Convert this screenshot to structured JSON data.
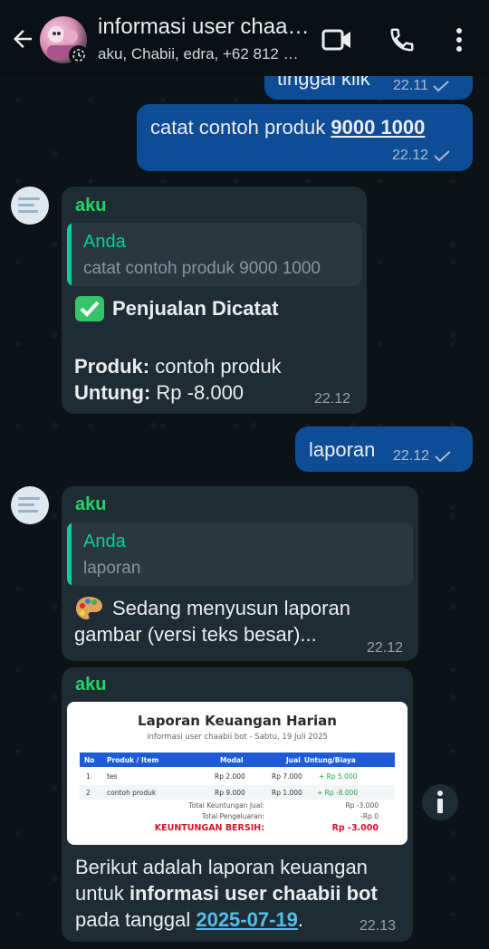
{
  "header": {
    "title": "informasi user chaabii bot",
    "members": "aku, Chabii, edra, +62 812 …",
    "icons": [
      "back-arrow-icon",
      "video-call-icon",
      "voice-call-icon",
      "more-vert-icon"
    ]
  },
  "colors": {
    "outgoing": "#0f4c96",
    "incoming": "#1f2c34",
    "sender": "#25d366",
    "quote_accent": "#06cf9c",
    "link": "#53bdeb"
  },
  "messages": [
    {
      "dir": "out",
      "text_partial": "tinggal klik",
      "time": "22.11",
      "status": "sent"
    },
    {
      "dir": "out",
      "text_prefix": "catat contoh produk ",
      "text_link": "9000 1000",
      "time": "22.12",
      "status": "sent"
    },
    {
      "dir": "in",
      "sender": "aku",
      "quote": {
        "name": "Anda",
        "text": "catat contoh produk 9000 1000"
      },
      "emoji": "✅",
      "title": "Penjualan Dicatat",
      "lines": [
        {
          "label": "Produk:",
          "value": "contoh produk"
        },
        {
          "label": "Untung:",
          "value": "Rp -8.000"
        }
      ],
      "time": "22.12"
    },
    {
      "dir": "out",
      "text": "laporan",
      "time": "22.12",
      "status": "sent"
    },
    {
      "dir": "in",
      "sender": "aku",
      "quote": {
        "name": "Anda",
        "text": "laporan"
      },
      "emoji": "🎨",
      "text": "Sedang menyusun laporan gambar (versi teks besar)...",
      "time": "22.12"
    },
    {
      "dir": "in",
      "sender": "aku",
      "report": {
        "title": "Laporan Keuangan Harian",
        "subtitle": "informasi user chaabii bot - Sabtu, 19 Juli 2025",
        "columns": [
          "No",
          "Produk / Item",
          "Modal",
          "Jual",
          "Untung/Biaya"
        ],
        "rows": [
          [
            "1",
            "tes",
            "Rp 2.000",
            "Rp 7.000",
            "+ Rp 5.000"
          ],
          [
            "2",
            "contoh produk",
            "Rp 9.000",
            "Rp 1.000",
            "+ Rp -8.000"
          ]
        ],
        "total_profit_label": "Total Keuntungan Jual:",
        "total_profit_value": "Rp -3.000",
        "total_expense_label": "Total Pengeluaran:",
        "total_expense_value": "-Rp 0",
        "net_label": "KEUNTUNGAN BERSIH:",
        "net_value": "Rp -3.000"
      },
      "caption_1": "Berikut adalah laporan keuangan untuk ",
      "caption_bold": "informasi user chaabii bot",
      "caption_2": " pada tanggal ",
      "caption_link": "2025-07-19",
      "caption_3": ".",
      "time": "22.13"
    }
  ]
}
